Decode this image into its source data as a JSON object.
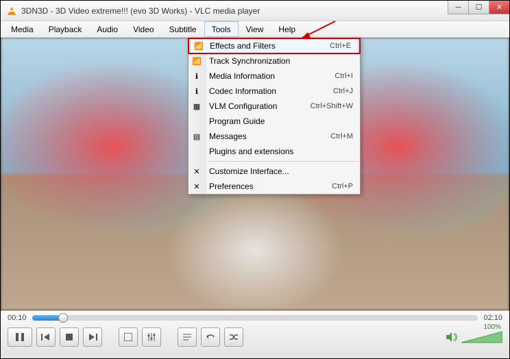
{
  "window": {
    "title": "3DN3D - 3D Video extreme!!! (evo 3D Works) - VLC media player"
  },
  "menubar": {
    "items": [
      "Media",
      "Playback",
      "Audio",
      "Video",
      "Subtitle",
      "Tools",
      "View",
      "Help"
    ],
    "active_index": 5
  },
  "tools_menu": {
    "groups": [
      [
        {
          "icon": "equalizer-icon",
          "label": "Effects and Filters",
          "shortcut": "Ctrl+E",
          "selected": true
        },
        {
          "icon": "sync-icon",
          "label": "Track Synchronization",
          "shortcut": ""
        },
        {
          "icon": "info-icon",
          "label": "Media Information",
          "shortcut": "Ctrl+I"
        },
        {
          "icon": "info-icon",
          "label": "Codec Information",
          "shortcut": "Ctrl+J"
        },
        {
          "icon": "vlm-icon",
          "label": "VLM Configuration",
          "shortcut": "Ctrl+Shift+W"
        },
        {
          "icon": "",
          "label": "Program Guide",
          "shortcut": ""
        },
        {
          "icon": "messages-icon",
          "label": "Messages",
          "shortcut": "Ctrl+M"
        },
        {
          "icon": "",
          "label": "Plugins and extensions",
          "shortcut": ""
        }
      ],
      [
        {
          "icon": "tools-icon",
          "label": "Customize Interface...",
          "shortcut": ""
        },
        {
          "icon": "prefs-icon",
          "label": "Preferences",
          "shortcut": "Ctrl+P"
        }
      ]
    ]
  },
  "playback": {
    "current_time": "00:10",
    "total_time": "02:10",
    "progress_pct": 7
  },
  "volume": {
    "percent_label": "100%",
    "level": 100
  }
}
